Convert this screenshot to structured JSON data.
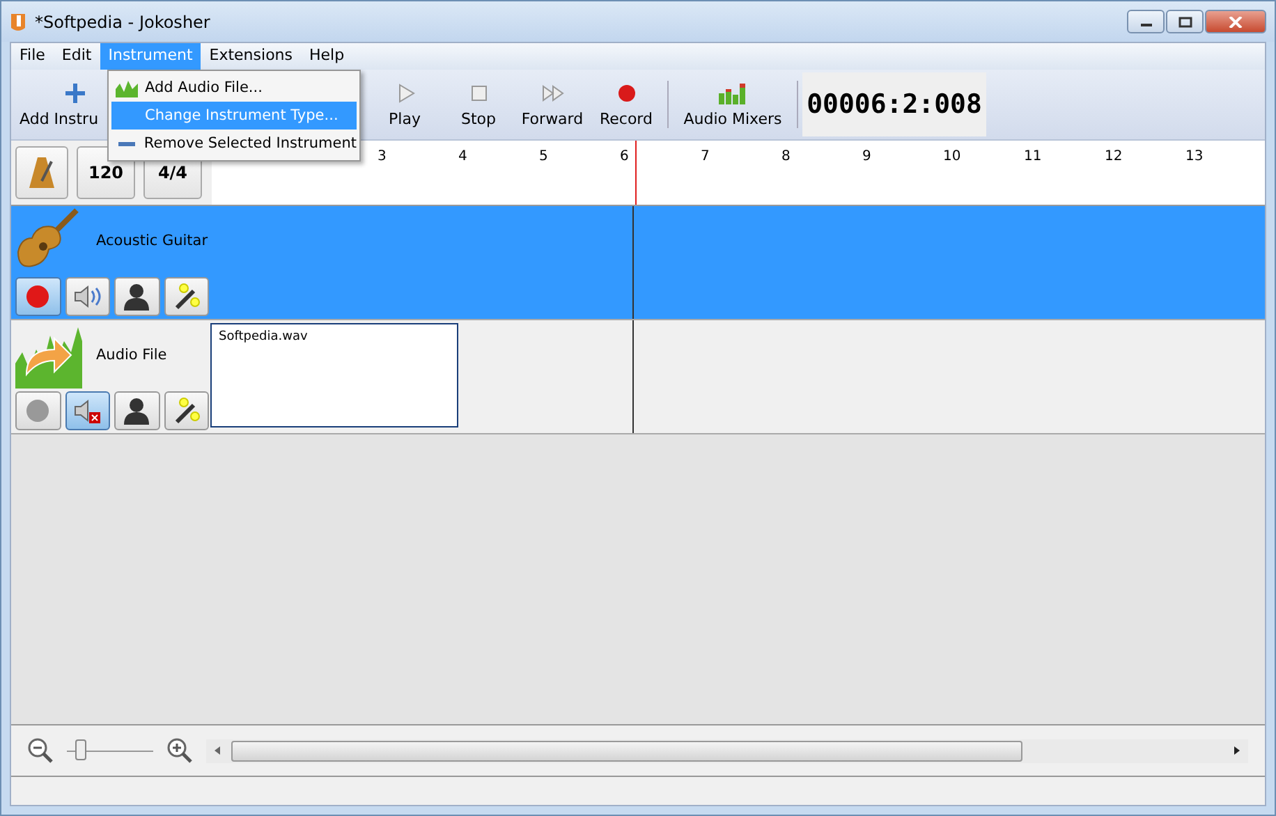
{
  "window": {
    "title": "*Softpedia - Jokosher"
  },
  "menu": [
    {
      "label": "File",
      "selected": false
    },
    {
      "label": "Edit",
      "selected": false
    },
    {
      "label": "Instrument",
      "selected": true
    },
    {
      "label": "Extensions",
      "selected": false
    },
    {
      "label": "Help",
      "selected": false
    }
  ],
  "dropdown": [
    {
      "label": "Add Audio File...",
      "kind": "audio",
      "selected": false
    },
    {
      "label": "Change Instrument Type...",
      "kind": "change",
      "selected": true
    },
    {
      "label": "Remove Selected Instrument",
      "kind": "remove",
      "selected": false
    }
  ],
  "toolbar": [
    {
      "label": "Add Instru",
      "kind": "add"
    },
    {
      "label": "Play",
      "kind": "play"
    },
    {
      "label": "Stop",
      "kind": "stop"
    },
    {
      "label": "Forward",
      "kind": "forward"
    },
    {
      "label": "Record",
      "kind": "record"
    },
    {
      "label": "Audio Mixers",
      "kind": "mixer"
    }
  ],
  "time": "00006:2:008",
  "tempo": "120",
  "meter": "4/4",
  "ruler": [
    "3",
    "4",
    "5",
    "6",
    "7",
    "8",
    "9",
    "10",
    "11",
    "12",
    "13"
  ],
  "tracks": [
    {
      "name": "Acoustic Guitar",
      "kind": "guitar",
      "selected": true,
      "armed": true,
      "muted": false
    },
    {
      "name": "Audio File",
      "kind": "audio",
      "selected": false,
      "armed": false,
      "muted": true,
      "clips": [
        {
          "label": "Softpedia.wav"
        }
      ]
    }
  ],
  "zoom": {
    "level": 0.1
  }
}
